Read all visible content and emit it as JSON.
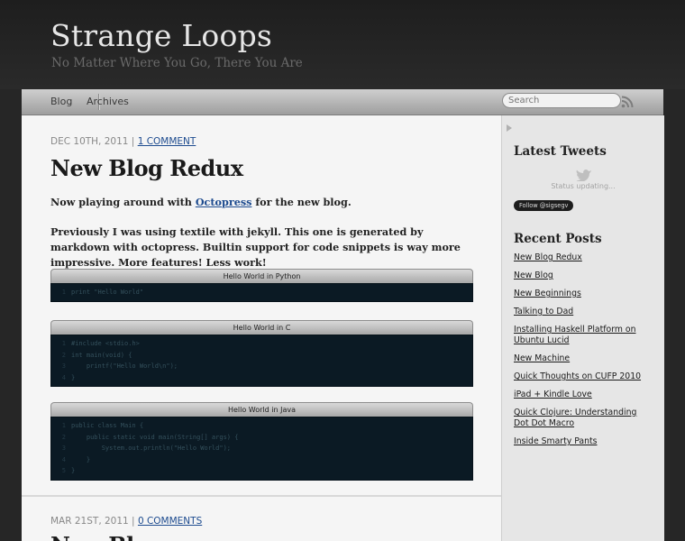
{
  "site": {
    "title": "Strange Loops",
    "subtitle": "No Matter Where You Go, There You Are"
  },
  "nav": {
    "items": [
      {
        "label": "Blog"
      },
      {
        "label": "Archives"
      }
    ],
    "search_placeholder": "Search"
  },
  "post1": {
    "date": "DEC 10TH, 2011",
    "separator": " | ",
    "comments": "1 COMMENT",
    "title": "New Blog Redux",
    "p1_before": "Now playing around with ",
    "p1_link": "Octopress",
    "p1_after": " for the new blog.",
    "p2": "Previously I was using textile with jekyll. This one is generated by markdown with octopress. Builtin support for code snippets is way more impressive. More features! Less work!"
  },
  "code_blocks": [
    {
      "title": "Hello World in Python",
      "lines": [
        "print \"Hello World\""
      ]
    },
    {
      "title": "Hello World in C",
      "lines": [
        "#include <stdio.h>",
        "int main(void) {",
        "    printf(\"Hello World\\n\");",
        "}"
      ]
    },
    {
      "title": "Hello World in Java",
      "lines": [
        "public class Main {",
        "    public static void main(String[] args) {",
        "        System.out.println(\"Hello World\");",
        "    }",
        "}"
      ]
    }
  ],
  "post2": {
    "date": "MAR 21ST, 2011",
    "separator": " | ",
    "comments": "0 COMMENTS",
    "title_partial": "New Blog"
  },
  "sidebar": {
    "tweets_heading": "Latest Tweets",
    "status": "Status updating...",
    "follow": "Follow @sigsegv",
    "recent_heading": "Recent Posts",
    "recent_posts": [
      "New Blog Redux",
      "New Blog",
      "New Beginnings",
      "Talking to Dad",
      "Installing Haskell Platform on Ubuntu Lucid",
      "New Machine",
      "Quick Thoughts on CUFP 2010",
      "iPad + Kindle Love",
      "Quick Clojure: Understanding Dot Dot Macro",
      "Inside Smarty Pants"
    ]
  },
  "colors": {
    "link": "#1d4b8f",
    "code_bg": "#0b1a24",
    "page_bg": "#f5f5f5"
  }
}
